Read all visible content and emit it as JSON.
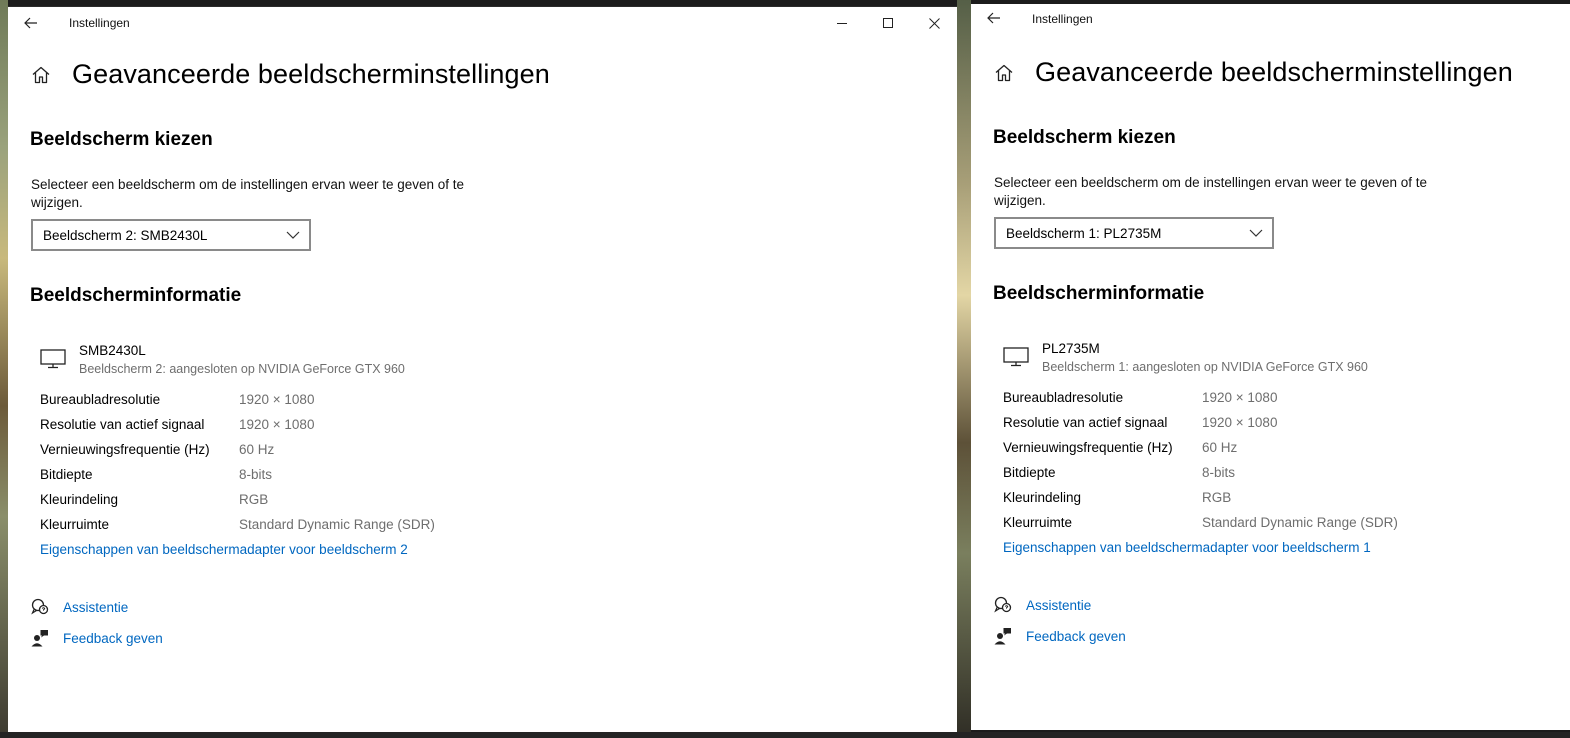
{
  "windows": [
    {
      "app_title": "Instellingen",
      "page_title": "Geavanceerde beeldscherminstellingen",
      "choose_section": {
        "title": "Beeldscherm kiezen",
        "description": "Selecteer een beeldscherm om de instellingen ervan weer te geven of te wijzigen.",
        "selected_display": "Beeldscherm 2: SMB2430L"
      },
      "info_section": {
        "title": "Beeldscherminformatie",
        "display_name": "SMB2430L",
        "display_subtitle": "Beeldscherm 2: aangesloten op NVIDIA GeForce GTX 960",
        "rows": [
          {
            "label": "Bureaubladresolutie",
            "value": "1920 × 1080"
          },
          {
            "label": "Resolutie van actief signaal",
            "value": "1920 × 1080"
          },
          {
            "label": "Vernieuwingsfrequentie (Hz)",
            "value": "60 Hz"
          },
          {
            "label": "Bitdiepte",
            "value": "8-bits"
          },
          {
            "label": "Kleurindeling",
            "value": "RGB"
          },
          {
            "label": "Kleurruimte",
            "value": "Standard Dynamic Range (SDR)"
          }
        ],
        "adapter_link": "Eigenschappen van beeldschermadapter voor beeldscherm 2"
      },
      "help": {
        "assist_label": "Assistentie",
        "feedback_label": "Feedback geven"
      }
    },
    {
      "app_title": "Instellingen",
      "page_title": "Geavanceerde beeldscherminstellingen",
      "choose_section": {
        "title": "Beeldscherm kiezen",
        "description": "Selecteer een beeldscherm om de instellingen ervan weer te geven of te wijzigen.",
        "selected_display": "Beeldscherm 1: PL2735M"
      },
      "info_section": {
        "title": "Beeldscherminformatie",
        "display_name": "PL2735M",
        "display_subtitle": "Beeldscherm 1: aangesloten op NVIDIA GeForce GTX 960",
        "rows": [
          {
            "label": "Bureaubladresolutie",
            "value": "1920 × 1080"
          },
          {
            "label": "Resolutie van actief signaal",
            "value": "1920 × 1080"
          },
          {
            "label": "Vernieuwingsfrequentie (Hz)",
            "value": "60 Hz"
          },
          {
            "label": "Bitdiepte",
            "value": "8-bits"
          },
          {
            "label": "Kleurindeling",
            "value": "RGB"
          },
          {
            "label": "Kleurruimte",
            "value": "Standard Dynamic Range (SDR)"
          }
        ],
        "adapter_link": "Eigenschappen van beeldschermadapter voor beeldscherm 1"
      },
      "help": {
        "assist_label": "Assistentie",
        "feedback_label": "Feedback geven"
      }
    }
  ],
  "icons": {
    "back": "back-arrow-icon",
    "home": "home-icon",
    "monitor": "monitor-icon",
    "chevron": "chevron-down-icon",
    "assist": "chat-help-icon",
    "feedback": "feedback-person-icon",
    "minimize": "minimize-icon",
    "maximize": "maximize-icon",
    "close": "close-icon"
  },
  "colors": {
    "link": "#0067c0",
    "secondary_text": "#6e6e6e",
    "dropdown_border": "#8a8a8a"
  }
}
